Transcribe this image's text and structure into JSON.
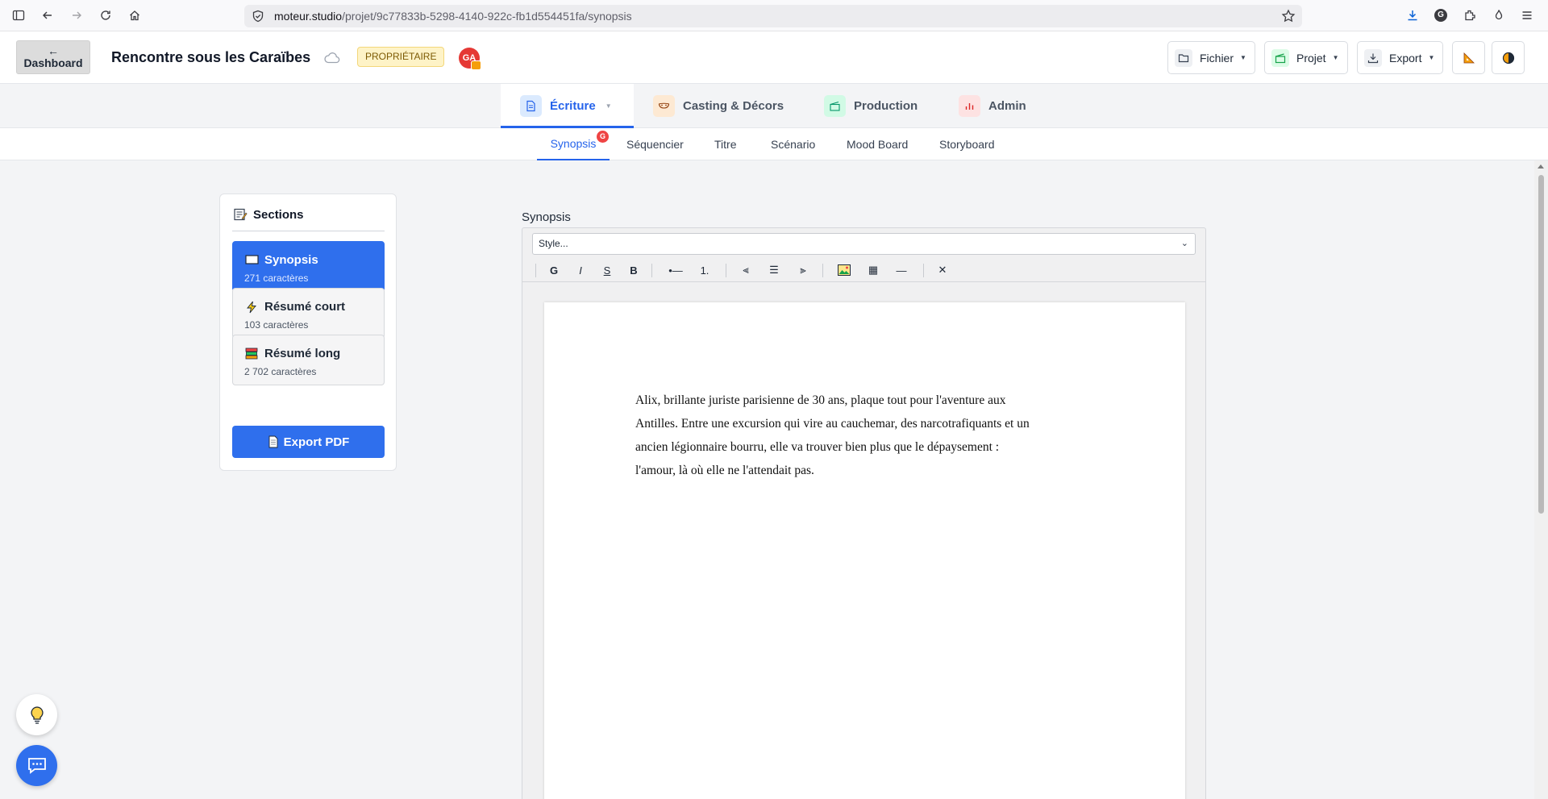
{
  "browser": {
    "url_domain": "moteur.studio",
    "url_path": "/projet/9c77833b-5298-4140-922c-fb1d554451fa/synopsis",
    "profile_initial": "G"
  },
  "header": {
    "dashboard_arrow": "←",
    "dashboard_label": "Dashboard",
    "project_title": "Rencontre sous les Caraïbes",
    "owner_badge": "PROPRIÉTAIRE",
    "avatar_initials": "GA",
    "file_menu": "Fichier",
    "project_menu": "Projet",
    "export_menu": "Export"
  },
  "main_tabs": {
    "writing": "Écriture",
    "casting": "Casting & Décors",
    "production": "Production",
    "admin": "Admin"
  },
  "sub_tabs": {
    "synopsis": "Synopsis",
    "synopsis_badge": "G",
    "sequencer": "Séquencier",
    "title": "Titre",
    "scenario": "Scénario",
    "mood_board": "Mood Board",
    "storyboard": "Storyboard"
  },
  "sections": {
    "heading": "Sections",
    "items": [
      {
        "label": "Synopsis",
        "count": "271 caractères"
      },
      {
        "label": "Résumé court",
        "count": "103 caractères"
      },
      {
        "label": "Résumé long",
        "count": "2 702 caractères"
      }
    ],
    "export_pdf": "Export PDF"
  },
  "editor": {
    "label": "Synopsis",
    "style_select": "Style...",
    "toolbar": {
      "bold_g": "G",
      "italic": "I",
      "strike": "S",
      "bold_b": "B",
      "bullet_list": "•—",
      "ordered_list": "1.",
      "align_left": "⫷",
      "align_center": "☰",
      "align_right": "⫸",
      "table": "▦",
      "hr": "—",
      "clear": "✕"
    },
    "lines": [
      "Alix, brillante juriste parisienne de 30 ans, plaque tout pour l'aventure aux",
      "Antilles. Entre une excursion qui vire au cauchemar, des narcotrafiquants et un",
      "ancien légionnaire bourru, elle va trouver bien plus que le dépaysement :",
      "l'amour, là où elle ne l'attendait pas."
    ]
  },
  "colors": {
    "accent": "#2563eb",
    "button_blue": "#2f6fed",
    "badge_red": "#ef4444",
    "owner_bg": "#fef3c7"
  }
}
